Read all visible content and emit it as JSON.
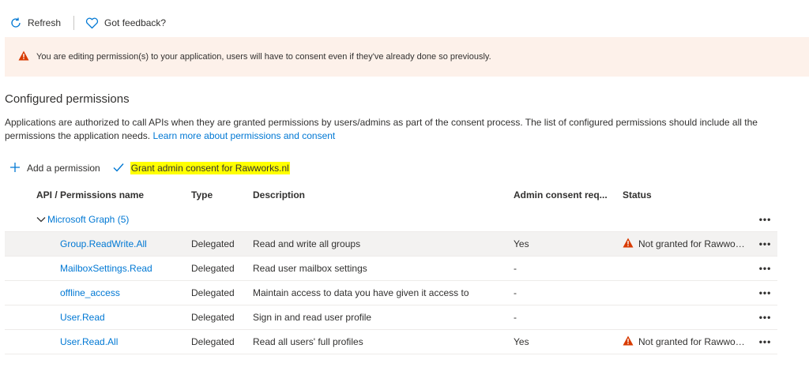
{
  "toolbar": {
    "refresh_label": "Refresh",
    "feedback_label": "Got feedback?"
  },
  "banner": {
    "text": "You are editing permission(s) to your application, users will have to consent even if they've already done so previously."
  },
  "section": {
    "title": "Configured permissions",
    "description": "Applications are authorized to call APIs when they are granted permissions by users/admins as part of the consent process. The list of configured permissions should include all the permissions the application needs.",
    "learn_more": "Learn more about permissions and consent"
  },
  "actions": {
    "add_permission": "Add a permission",
    "grant_consent": "Grant admin consent for Rawworks.nl"
  },
  "table": {
    "headers": {
      "api": "API / Permissions name",
      "type": "Type",
      "description": "Description",
      "admin": "Admin consent req...",
      "status": "Status"
    },
    "group": "Microsoft Graph (5)",
    "more": "•••",
    "rows": [
      {
        "name": "Group.ReadWrite.All",
        "type": "Delegated",
        "description": "Read and write all groups",
        "admin": "Yes",
        "status": "Not granted for Rawwor..."
      },
      {
        "name": "MailboxSettings.Read",
        "type": "Delegated",
        "description": "Read user mailbox settings",
        "admin": "-",
        "status": ""
      },
      {
        "name": "offline_access",
        "type": "Delegated",
        "description": "Maintain access to data you have given it access to",
        "admin": "-",
        "status": ""
      },
      {
        "name": "User.Read",
        "type": "Delegated",
        "description": "Sign in and read user profile",
        "admin": "-",
        "status": ""
      },
      {
        "name": "User.Read.All",
        "type": "Delegated",
        "description": "Read all users' full profiles",
        "admin": "Yes",
        "status": "Not granted for Rawwor..."
      }
    ]
  },
  "colors": {
    "accent": "#0078d4",
    "warning": "#d83b01",
    "warning_bg": "#fdf1ea",
    "highlight": "#ffff00"
  }
}
